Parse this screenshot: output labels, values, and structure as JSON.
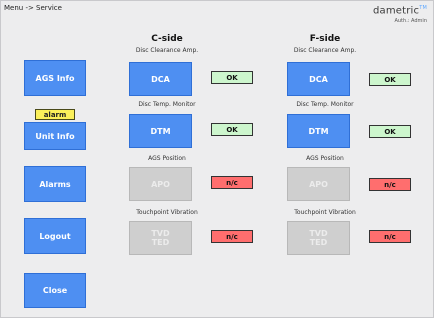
{
  "header": {
    "breadcrumb": "Menu -> Service",
    "brand_name": "dametric",
    "brand_mark": "TM",
    "auth": "Auth.: Admin"
  },
  "nav": {
    "ags_info": "AGS Info",
    "alarm_badge": "alarm",
    "unit_info": "Unit Info",
    "alarms": "Alarms",
    "logout": "Logout",
    "close": "Close"
  },
  "c_side": {
    "title": "C-side",
    "modules": [
      {
        "label": "Disc Clearance Amp.",
        "button": "DCA",
        "status": "OK"
      },
      {
        "label": "Disc Temp. Monitor",
        "button": "DTM",
        "status": "OK"
      },
      {
        "label": "AGS Position",
        "button": "APO",
        "status": "n/c"
      },
      {
        "label": "Touchpoint Vibration",
        "button_line1": "TVD",
        "button_line2": "TED",
        "status": "n/c"
      }
    ]
  },
  "f_side": {
    "title": "F-side",
    "modules": [
      {
        "label": "Disc Clearance Amp.",
        "button": "DCA",
        "status": "OK"
      },
      {
        "label": "Disc Temp. Monitor",
        "button": "DTM",
        "status": "OK"
      },
      {
        "label": "AGS Position",
        "button": "APO",
        "status": "n/c"
      },
      {
        "label": "Touchpoint Vibration",
        "button_line1": "TVD",
        "button_line2": "TED",
        "status": "n/c"
      }
    ]
  },
  "colors": {
    "button_blue": "#4e8ff2",
    "ok_green": "#cdf6cd",
    "nc_red": "#ff6e6e",
    "alarm_yellow": "#fbf05a",
    "disabled_gray": "#cfcfcf"
  }
}
